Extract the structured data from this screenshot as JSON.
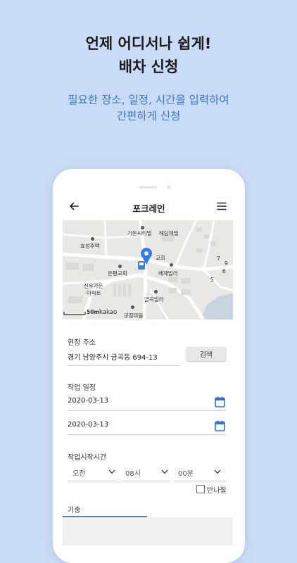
{
  "promo": {
    "headline_line1": "언제 어디서나 쉽게!",
    "headline_line2": "배차 신청",
    "sub_line1": "필요한 장소, 일정, 시간을 입력하여",
    "sub_line2": "간편하게 신청"
  },
  "appbar": {
    "title": "포크레인",
    "back_icon": "arrow-left-icon",
    "menu_icon": "hamburger-menu-icon"
  },
  "map": {
    "labels": [
      "가든씨티빌",
      "해담채빌",
      "효성주택",
      "교회",
      "은평교회",
      "배재빌라",
      "신우가든",
      "아파트",
      "금곡빌라",
      "군장마을",
      "7",
      "9",
      "6",
      "5"
    ],
    "scale": "50m",
    "brand": "kakao",
    "marker_icon": "location-pin-icon",
    "bus_icon": "bus-stop-icon"
  },
  "form": {
    "address_label": "현장 주소",
    "address_value": "경기 남양주시 금곡동 694-13",
    "search_button": "검색",
    "schedule_label": "작업 일정",
    "start_date": "2020-03-13",
    "end_date": "2020-03-13",
    "calendar_icon": "calendar-icon",
    "start_time_label": "작업시작시간",
    "ampm_value": "오전",
    "hour_value": "08시",
    "minute_value": "00분",
    "half_day_label": "반나절",
    "half_day_checked": false,
    "equipment_label": "기종"
  },
  "colors": {
    "background": "#c9dcf7",
    "accent_text": "#3f76d0",
    "calendar_blue": "#2f6fd6",
    "marker_blue": "#2f7ef0"
  }
}
